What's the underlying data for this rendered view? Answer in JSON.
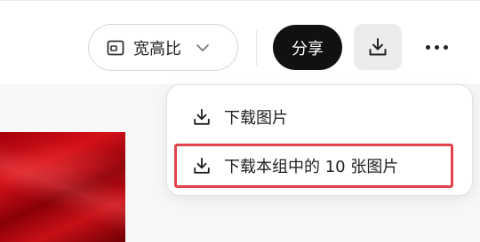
{
  "toolbar": {
    "aspect_label": "宽高比",
    "share_label": "分享"
  },
  "download_menu": {
    "items": [
      {
        "label": "下载图片",
        "icon": "download-icon"
      },
      {
        "label": "下载本组中的 10 张图片",
        "icon": "download-icon",
        "highlighted": true
      }
    ]
  },
  "icons": {
    "aspect": "aspect-ratio-icon",
    "chevron": "chevron-down-icon",
    "download": "download-icon",
    "more": "more-horizontal-icon"
  },
  "colors": {
    "share_bg": "#111111",
    "highlight_border": "#e0434b",
    "thumbnail_red": "#c80f16"
  }
}
